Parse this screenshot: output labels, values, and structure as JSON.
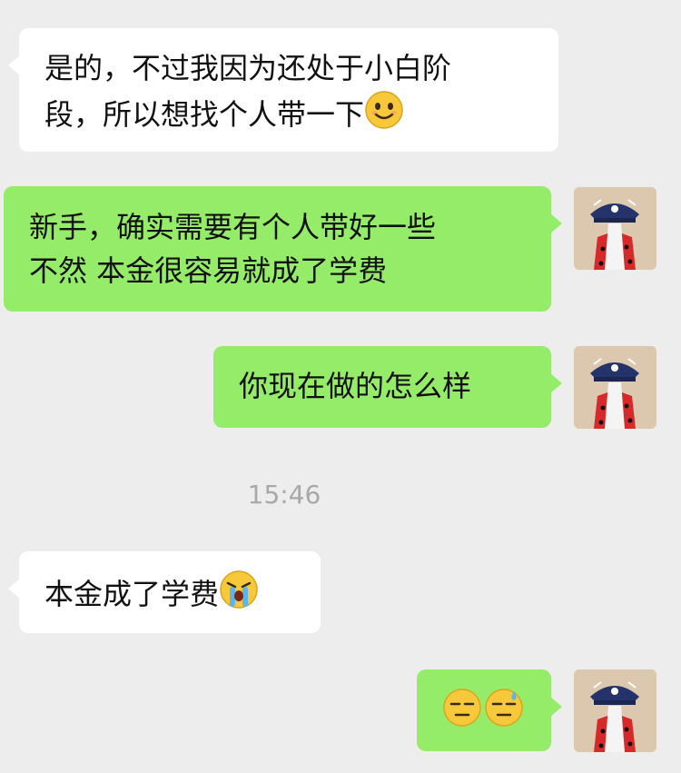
{
  "messages": [
    {
      "side": "in",
      "text_line1": "是的，不过我因为还处于小白阶",
      "text_line2": "段，所以想找个人带一下",
      "emoji": "smile-emoji"
    },
    {
      "side": "out",
      "text_line1": "新手，确实需要有个人带好一些",
      "text_line2": "不然 本金很容易就成了学费"
    },
    {
      "side": "out",
      "text": "你现在做的怎么样"
    },
    {
      "side": "in",
      "text": "本金成了学费",
      "emoji": "crying-emoji"
    },
    {
      "side": "out",
      "emojis": [
        "sweat-emoji",
        "sweat-emoji"
      ]
    }
  ],
  "timestamp": "15:46",
  "colors": {
    "background": "#ededed",
    "incoming": "#ffffff",
    "outgoing": "#95ec69",
    "timestamp": "#a8a8a8"
  }
}
